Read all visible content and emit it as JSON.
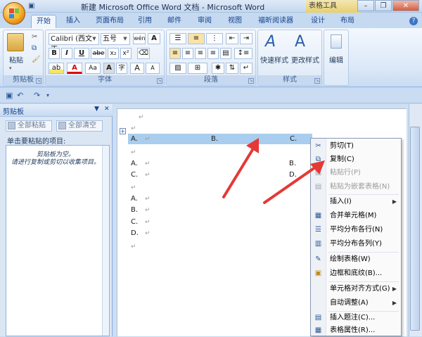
{
  "window": {
    "title": "新建 Microsoft Office Word 文档 - Microsoft Word",
    "context_tab": "表格工具"
  },
  "tabs": [
    {
      "label": "开始",
      "active": true
    },
    {
      "label": "插入",
      "active": false
    },
    {
      "label": "页面布局",
      "active": false
    },
    {
      "label": "引用",
      "active": false
    },
    {
      "label": "邮件",
      "active": false
    },
    {
      "label": "审阅",
      "active": false
    },
    {
      "label": "视图",
      "active": false
    },
    {
      "label": "福昕阅读器",
      "active": false
    },
    {
      "label": "设计",
      "active": false
    },
    {
      "label": "布局",
      "active": false
    }
  ],
  "ribbon": {
    "clipboard": {
      "label": "剪贴板",
      "paste_label": "粘贴"
    },
    "font": {
      "label": "字体",
      "font_name": "Calibri (西文正",
      "font_size": "五号",
      "bold": "B",
      "italic": "I",
      "underline": "U",
      "strike": "abe",
      "subscript": "x₂",
      "superscript": "x²",
      "case": "Aa",
      "grow": "A",
      "shrink": "A",
      "wen_a": "wén",
      "font_color": "A",
      "char_border": "A",
      "clear_format": "A",
      "char_shade": "字"
    },
    "paragraph": {
      "label": "段落"
    },
    "styles": {
      "label": "样式",
      "quick": "快速样式",
      "change": "更改样式"
    },
    "editing": {
      "label": "编辑"
    }
  },
  "clipboard_pane": {
    "title": "剪贴板",
    "paste_all": "全部粘贴",
    "clear_all": "全部清空",
    "hint": "单击要粘贴的项目:",
    "empty_msg": "剪贴板为空。\n请进行复制或剪切以收集项目。"
  },
  "document": {
    "row1": {
      "a": "A.",
      "b": "B.",
      "c": "C."
    },
    "block2": {
      "a": "A.",
      "c": "C.",
      "b": "B.",
      "d": "D."
    },
    "list3": [
      "A.",
      "B.",
      "C.",
      "D."
    ]
  },
  "context_menu": {
    "items": [
      {
        "label": "剪切(T)",
        "icon": "scissors-icon",
        "enabled": true
      },
      {
        "label": "复制(C)",
        "icon": "copy-icon",
        "enabled": true
      },
      {
        "label": "粘贴行(P)",
        "icon": "paste-icon",
        "enabled": false
      },
      {
        "label": "粘贴为嵌套表格(N)",
        "icon": "paste-nested-icon",
        "enabled": false
      },
      {
        "label": "插入(I)",
        "icon": "",
        "enabled": true,
        "submenu": true
      },
      {
        "label": "合并单元格(M)",
        "icon": "merge-cells-icon",
        "enabled": true
      },
      {
        "label": "平均分布各行(N)",
        "icon": "distribute-rows-icon",
        "enabled": true
      },
      {
        "label": "平均分布各列(Y)",
        "icon": "distribute-columns-icon",
        "enabled": true
      },
      {
        "label": "绘制表格(W)",
        "icon": "draw-table-icon",
        "enabled": true
      },
      {
        "label": "边框和底纹(B)...",
        "icon": "borders-icon",
        "enabled": true
      },
      {
        "label": "单元格对齐方式(G)",
        "icon": "",
        "enabled": true,
        "submenu": true
      },
      {
        "label": "自动调整(A)",
        "icon": "",
        "enabled": true,
        "submenu": true
      },
      {
        "label": "插入题注(C)...",
        "icon": "caption-icon",
        "enabled": true
      },
      {
        "label": "表格属性(R)...",
        "icon": "table-properties-icon",
        "enabled": true
      }
    ]
  },
  "colors": {
    "annotation_arrow": "#e53935",
    "selection": "#a9cdee"
  }
}
